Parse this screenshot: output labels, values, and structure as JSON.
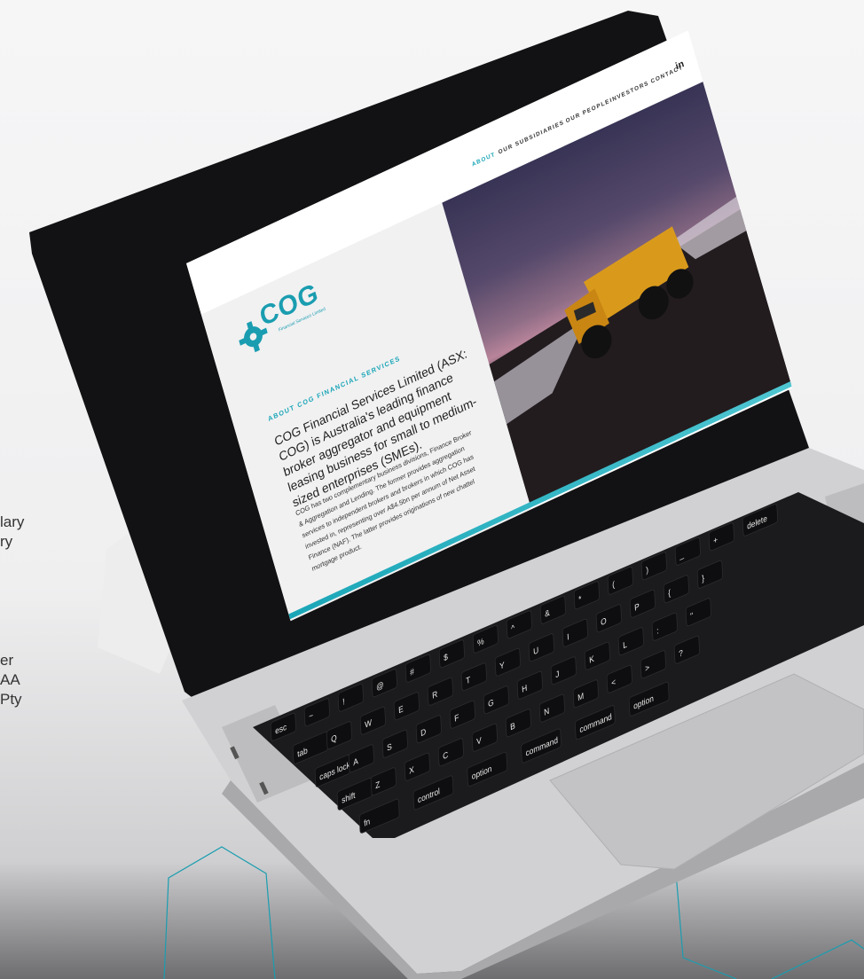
{
  "side_text": {
    "lines": [
      "lary",
      "ry",
      "",
      "er",
      "AA",
      "Pty"
    ]
  },
  "site": {
    "logo": {
      "name": "COG",
      "subtitle": "Financial Services Limited"
    },
    "nav": {
      "items": [
        "ABOUT",
        "OUR SUBSIDIARIES",
        "OUR PEOPLE",
        "INVESTORS",
        "CONTACT"
      ],
      "social": "in"
    },
    "about": {
      "heading": "ABOUT COG FINANCIAL SERVICES",
      "lead": "COG Financial Services Limited (ASX: COG) is Australia's leading finance broker aggregator and equipment leasing business for small to medium-sized enterprises (SMEs).",
      "body": "COG has two complementary business divisions, Finance Broker & Aggregation and Lending. The former provides aggregation services to independent brokers and brokers in which COG has invested in, representing over A$4.5bn per annum of Net Asset Finance (NAF). The latter provides originations of new chattel mortgage product."
    }
  },
  "keyboard": {
    "keys": [
      "esc",
      "~",
      "!",
      "@",
      "#",
      "$",
      "%",
      "^",
      "&",
      "*",
      "(",
      ")",
      "_",
      "+",
      "delete",
      "tab",
      "Q",
      "W",
      "E",
      "R",
      "T",
      "Y",
      "U",
      "I",
      "O",
      "P",
      "{",
      "}",
      "caps lock",
      "A",
      "S",
      "D",
      "F",
      "G",
      "H",
      "J",
      "K",
      "L",
      ":",
      "\"",
      "shift",
      "Z",
      "X",
      "C",
      "V",
      "B",
      "N",
      "M",
      "<",
      ">",
      "?",
      "fn",
      "control",
      "option",
      "command",
      "command",
      "option"
    ]
  },
  "colors": {
    "accent": "#1aa6b7",
    "keyboard": "#1b1b1d",
    "chassis": "#c9c9cb"
  }
}
